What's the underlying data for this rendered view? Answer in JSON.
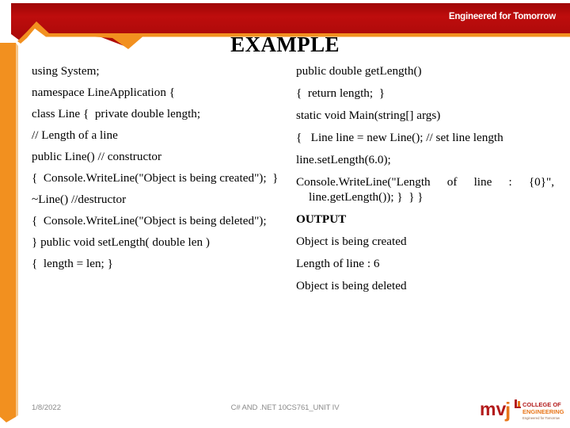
{
  "banner": {
    "tagline": "Engineered for Tomorrow",
    "red": "#B80D0D",
    "orange": "#F2901F"
  },
  "title": "EXAMPLE",
  "columns": {
    "left": [
      "using System;",
      "namespace LineApplication {",
      "class Line {  private double length;",
      "// Length of a line",
      "public Line() // constructor",
      "{  Console.WriteLine(\"Object is being created\");  }",
      "~Line() //destructor",
      "{  Console.WriteLine(\"Object is being deleted\");",
      "} public void setLength( double len )",
      "{  length = len; }"
    ],
    "right": [
      "public double getLength()",
      "{  return length;  }",
      "static void Main(string[] args)",
      "{   Line line = new Line(); // set line length",
      "line.setLength(6.0);",
      "Console.WriteLine(\"Length of line : {0}\", line.getLength()); }  } }",
      "OUTPUT",
      "Object is being created",
      "Length of line : 6",
      "Object is being deleted"
    ]
  },
  "footer": {
    "date": "1/8/2022",
    "center": "C# AND .NET 10CS761_UNIT IV"
  },
  "logo": {
    "wordmark": "mvj",
    "line1": "COLLEGE OF",
    "line2": "ENGINEERING",
    "tagline": "Engineered for Tomorrow",
    "red": "#B31B1B",
    "orange": "#E8761A"
  }
}
